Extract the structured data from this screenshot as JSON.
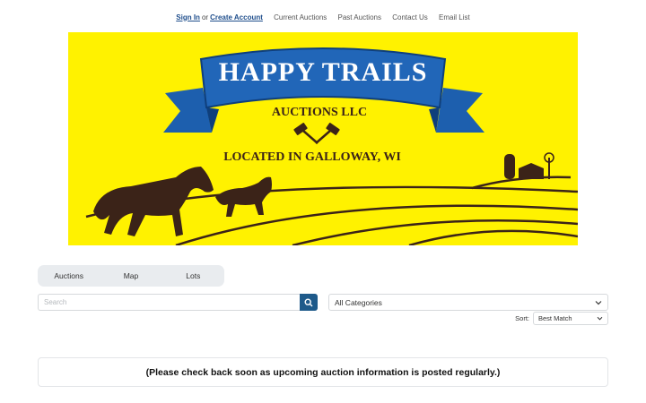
{
  "nav": {
    "sign_in": "Sign In",
    "or": "or",
    "create_account": "Create Account",
    "links": [
      "Current Auctions",
      "Past Auctions",
      "Contact Us",
      "Email List"
    ]
  },
  "banner": {
    "title": "HAPPY TRAILS",
    "subtitle": "AUCTIONS LLC",
    "location": "LOCATED IN GALLOWAY, WI",
    "colors": {
      "background": "#fff200",
      "ribbon": "#1d5fae",
      "ink": "#3b2318"
    }
  },
  "tabs": [
    "Auctions",
    "Map",
    "Lots"
  ],
  "search": {
    "placeholder": "Search",
    "button_icon": "search-icon"
  },
  "category": {
    "selected": "All Categories"
  },
  "sort": {
    "label": "Sort:",
    "selected": "Best Match"
  },
  "notice": "(Please check back soon as upcoming auction information is posted regularly.)",
  "colors": {
    "accent": "#1e5a8a",
    "link": "#1f4e8c"
  }
}
